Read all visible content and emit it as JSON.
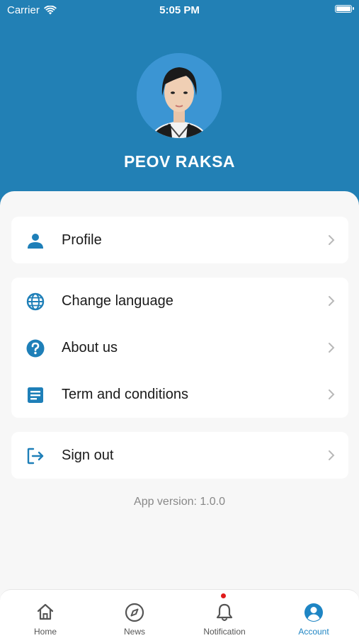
{
  "status": {
    "carrier": "Carrier",
    "time": "5:05 PM"
  },
  "profile": {
    "name": "PEOV RAKSA"
  },
  "menu": {
    "profile": {
      "label": "Profile",
      "icon": "person-icon"
    },
    "change_language": {
      "label": "Change language",
      "icon": "globe-icon"
    },
    "about_us": {
      "label": "About us",
      "icon": "help-circle-icon"
    },
    "terms": {
      "label": "Term and conditions",
      "icon": "document-icon"
    },
    "sign_out": {
      "label": "Sign out",
      "icon": "sign-out-icon"
    }
  },
  "app_version": "App version: 1.0.0",
  "tabs": [
    {
      "label": "Home",
      "icon": "home-icon"
    },
    {
      "label": "News",
      "icon": "compass-icon"
    },
    {
      "label": "Notification",
      "icon": "bell-icon"
    },
    {
      "label": "Account",
      "icon": "account-icon"
    }
  ],
  "colors": {
    "brand": "#2280b5",
    "accent": "#1e85c4",
    "notification_dot": "#e01b1b"
  }
}
